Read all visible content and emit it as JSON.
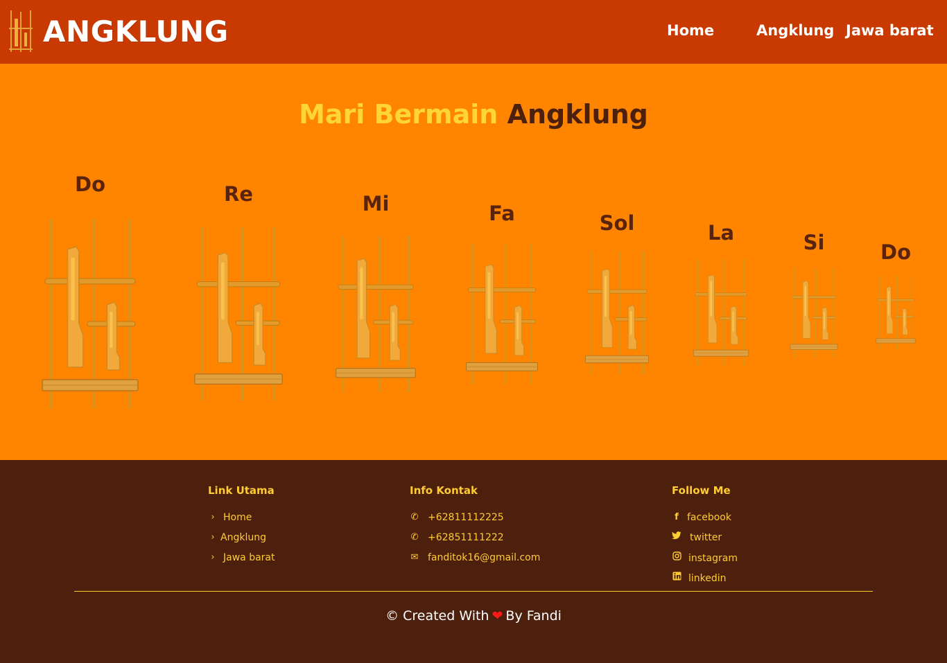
{
  "header": {
    "logo_text": "ANGKLUNG",
    "nav": [
      {
        "label": "Home"
      },
      {
        "label": "Angklung"
      },
      {
        "label": "Jawa barat"
      }
    ]
  },
  "main": {
    "title_part1": "Mari Bermain",
    "title_part2": "Angklung",
    "notes": [
      {
        "label": "Do"
      },
      {
        "label": "Re"
      },
      {
        "label": "Mi"
      },
      {
        "label": "Fa"
      },
      {
        "label": "Sol"
      },
      {
        "label": "La"
      },
      {
        "label": "Si"
      },
      {
        "label": "Do"
      }
    ]
  },
  "footer": {
    "links_title": "Link Utama",
    "links": [
      {
        "label": "Home",
        "icon": "chevron-right-icon"
      },
      {
        "label": "Angklung",
        "icon": "chevron-right-icon"
      },
      {
        "label": "Jawa barat",
        "icon": "chevron-right-icon"
      }
    ],
    "contact_title": "Info Kontak",
    "contacts": [
      {
        "label": "+62811112225",
        "icon": "phone-icon"
      },
      {
        "label": "+62851111222",
        "icon": "phone-icon"
      },
      {
        "label": "fanditok16@gmail.com",
        "icon": "envelope-icon"
      }
    ],
    "follow_title": "Follow Me",
    "socials": [
      {
        "label": "facebook",
        "icon": "facebook-icon"
      },
      {
        "label": "twitter",
        "icon": "twitter-icon"
      },
      {
        "label": "instagram",
        "icon": "instagram-icon"
      },
      {
        "label": "linkedin",
        "icon": "linkedin-icon"
      }
    ],
    "credit_before": "© Created With",
    "credit_after": "By Fandi"
  },
  "colors": {
    "header_bg": "#c93a02",
    "main_bg": "#ff8500",
    "footer_bg": "#4d1f0d",
    "accent_yellow": "#ffcc33",
    "title_yellow": "#ffd633",
    "heart_red": "#ff1a1a"
  }
}
